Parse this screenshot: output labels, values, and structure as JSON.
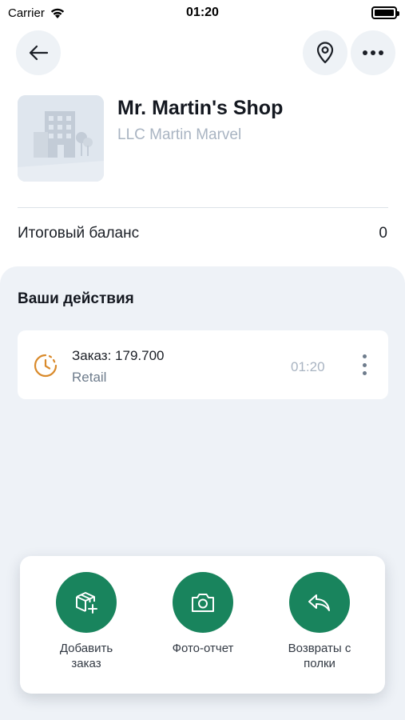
{
  "status_bar": {
    "carrier": "Carrier",
    "time": "01:20",
    "icons": [
      "wifi-icon",
      "battery-icon"
    ]
  },
  "nav": {
    "back_icon": "arrow-left-icon",
    "location_icon": "map-pin-icon",
    "more_icon": "more-horizontal-icon"
  },
  "shop": {
    "name": "Mr. Martin's Shop",
    "legal_name": "LLC Martin Marvel",
    "image_icon": "building-placeholder-icon"
  },
  "balance": {
    "label": "Итоговый баланс",
    "value": "0"
  },
  "actions": {
    "title": "Ваши действия",
    "items": [
      {
        "label": "Заказ: 179.700",
        "type": "Retail",
        "time": "01:20",
        "icon": "clock-icon",
        "menu_icon": "more-vertical-icon"
      }
    ]
  },
  "sheet": {
    "buttons": [
      {
        "label_line1": "Добавить",
        "label_line2": "заказ",
        "icon": "box-add-icon"
      },
      {
        "label_line1": "Фото-отчет",
        "label_line2": "",
        "icon": "camera-icon"
      },
      {
        "label_line1": "Возвраты с",
        "label_line2": "полки",
        "icon": "return-arrow-icon"
      }
    ]
  },
  "colors": {
    "accent_green": "#19845d",
    "clock_orange": "#d98a2b",
    "panel_bg": "#eef2f7",
    "muted_text": "#a9b4c2"
  }
}
